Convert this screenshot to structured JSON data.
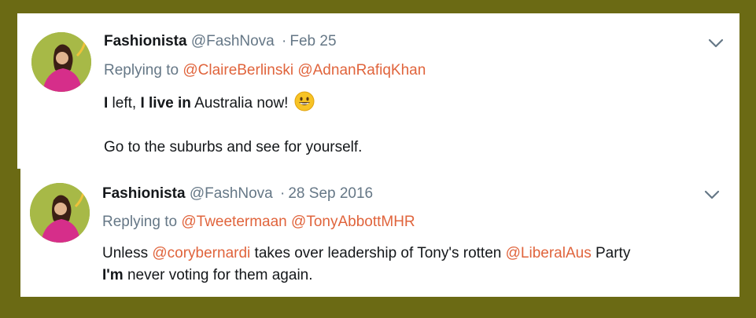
{
  "tweets": [
    {
      "display_name": "Fashionista",
      "handle": "@FashNova",
      "separator": "·",
      "date": "Feb 25",
      "replying_prefix": "Replying to",
      "replying_to": [
        "@ClaireBerlinski",
        "@AdnanRafiqKhan"
      ],
      "line1_part1_bold": "I",
      "line1_part2": " left, ",
      "line1_part3_bold": "I live in",
      "line1_part4": " Australia now!",
      "emoji_icon": "grinning-face-icon",
      "line2": "Go to the suburbs and see for yourself."
    },
    {
      "display_name": "Fashionista",
      "handle": "@FashNova",
      "separator": "·",
      "date": "28 Sep 2016",
      "replying_prefix": "Replying to",
      "replying_to": [
        "@Tweetermaan",
        "@TonyAbbottMHR"
      ],
      "line1_part1": "Unless ",
      "line1_mention1": "@corybernardi",
      "line1_part2": " takes over leadership of Tony's rotten ",
      "line1_mention2": "@LiberalAus",
      "line1_part3": " Party",
      "line2_bold": "I'm",
      "line2_rest": " never voting for them again."
    }
  ],
  "colors": {
    "frame": "#6b6a14",
    "mention": "#e0643c",
    "muted": "#657786",
    "text": "#14171a"
  }
}
